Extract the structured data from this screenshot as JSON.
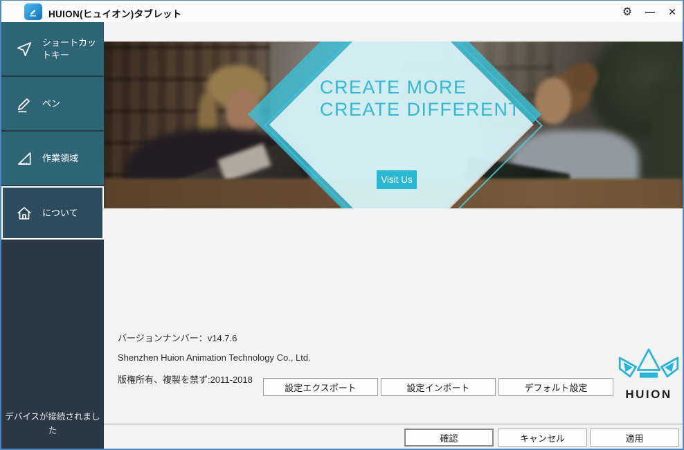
{
  "window": {
    "title": "HUION(ヒュイオン)タブレット",
    "border_color": "#4f87c5"
  },
  "titlebar": {
    "controls": {
      "gear": "⚙",
      "minimize": "—",
      "close": "✕"
    }
  },
  "sidebar": {
    "items": [
      {
        "label": "ショートカットキー",
        "icon": "cursor-icon",
        "selected": false
      },
      {
        "label": "ペン",
        "icon": "pen-icon",
        "selected": false
      },
      {
        "label": "作業領域",
        "icon": "work-area-icon",
        "selected": false
      },
      {
        "label": "について",
        "icon": "home-icon",
        "selected": true
      }
    ],
    "status": "デバイスが接続されました",
    "colors": {
      "item_bg": "#2e6576",
      "selected_bg": "#2c4c5d",
      "panel_bg": "#2b3845"
    }
  },
  "hero": {
    "headline_line1": "CREATE MORE",
    "headline_line2": "CREATE DIFFERENT",
    "visit_button_label": "Visit Us",
    "accent_color": "#35b8cf"
  },
  "about": {
    "version_line": "バージョンナンバー：v14.7.6",
    "company_line": "Shenzhen Huion Animation Technology Co., Ltd.",
    "copyright_line": "版権所有、複製を禁ず:2011-2018",
    "export_button": "設定エクスポート",
    "import_button": "設定インポート",
    "default_button": "デフォルト設定",
    "brand_name": "HUION",
    "brand_color": "#2ab5d6"
  },
  "footer": {
    "confirm_button": "確認",
    "cancel_button": "キャンセル",
    "apply_button": "適用"
  }
}
